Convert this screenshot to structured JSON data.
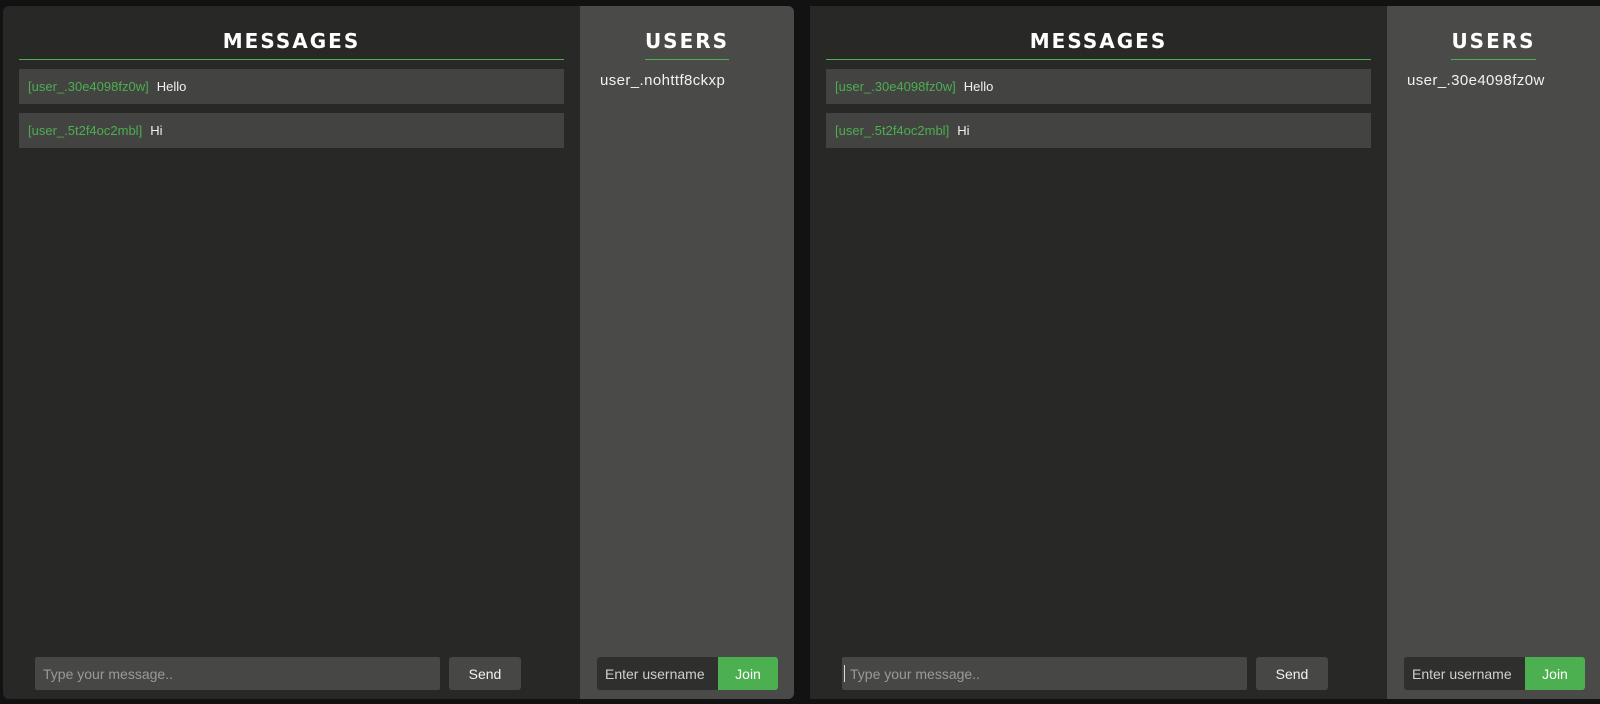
{
  "windows": [
    {
      "messages_title": "MESSAGES",
      "users_title": "USERS",
      "messages": [
        {
          "user": "[user_.30e4098fz0w]",
          "text": "Hello"
        },
        {
          "user": "[user_.5t2f4oc2mbl]",
          "text": "Hi"
        }
      ],
      "users": [
        "user_.nohttf8ckxp"
      ],
      "message_placeholder": "Type your message..",
      "send_label": "Send",
      "username_placeholder": "Enter username",
      "join_label": "Join"
    },
    {
      "messages_title": "MESSAGES",
      "users_title": "USERS",
      "messages": [
        {
          "user": "[user_.30e4098fz0w]",
          "text": "Hello"
        },
        {
          "user": "[user_.5t2f4oc2mbl]",
          "text": "Hi"
        }
      ],
      "users": [
        "user_.30e4098fz0w"
      ],
      "message_placeholder": "Type your message..",
      "send_label": "Send",
      "username_placeholder": "Enter username",
      "join_label": "Join"
    }
  ],
  "colors": {
    "accent": "#4caf50",
    "panel_bg": "#282826",
    "users_bg": "#4a4a48",
    "message_bg": "#434341"
  }
}
